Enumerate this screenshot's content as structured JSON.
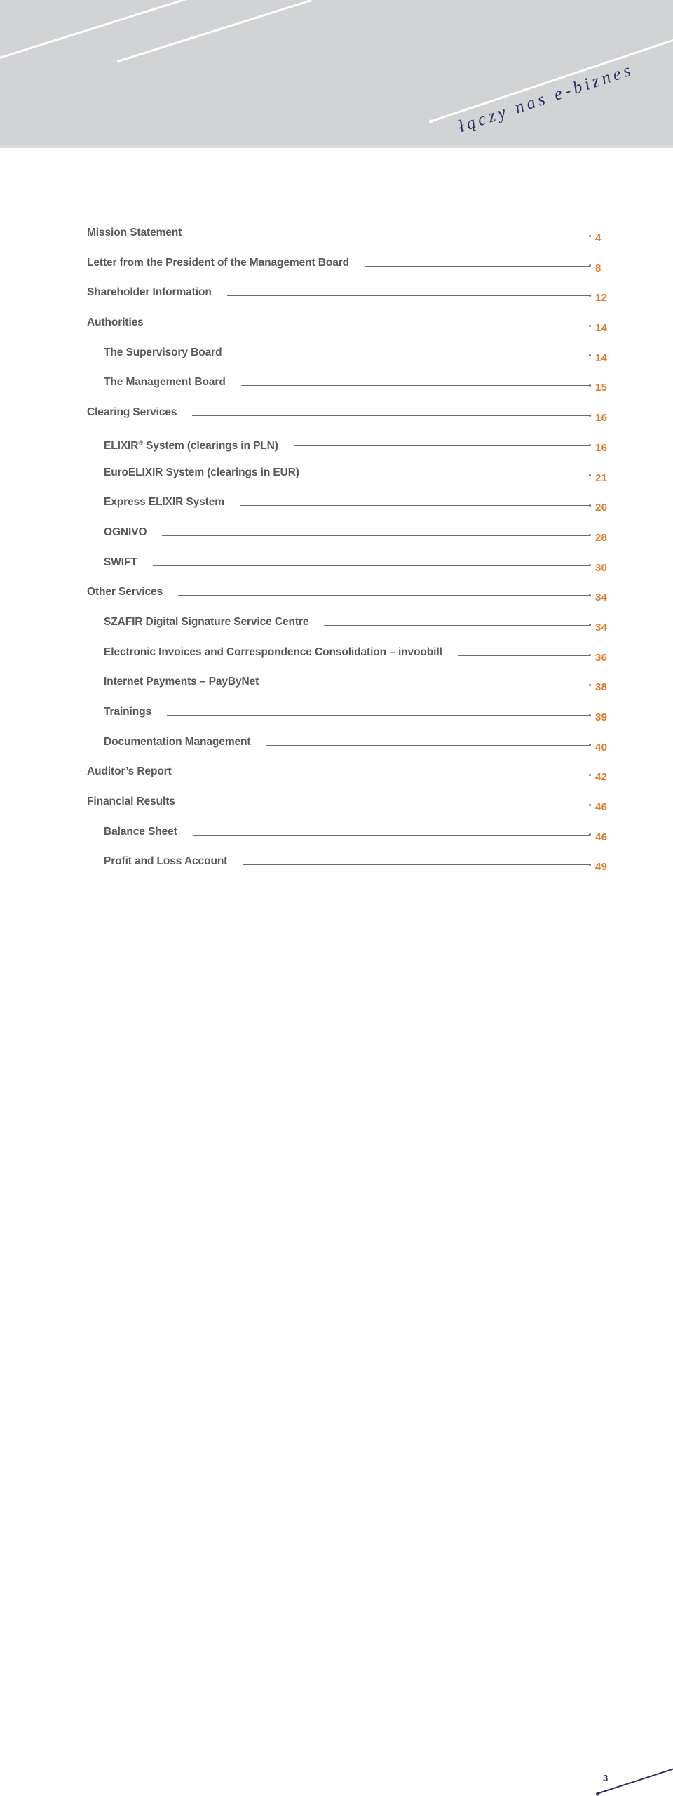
{
  "header": {
    "tagline": "łączy nas e-biznes",
    "band_color": "#d2d3d5",
    "tagline_color": "#2b3360"
  },
  "toc": {
    "label_color": "#58595b",
    "page_number_color": "#e07b2a",
    "leader_color": "#6d6e71",
    "entries": [
      {
        "label": "Mission Statement",
        "page": "4",
        "level": 0
      },
      {
        "label": "Letter from the President of the Management Board",
        "page": "8",
        "level": 0
      },
      {
        "label": "Shareholder Information",
        "page": "12",
        "level": 0
      },
      {
        "label": "Authorities",
        "page": "14",
        "level": 0
      },
      {
        "label": "The Supervisory Board",
        "page": "14",
        "level": 1
      },
      {
        "label": "The Management Board",
        "page": "15",
        "level": 1
      },
      {
        "label": "Clearing Services",
        "page": "16",
        "level": 0
      },
      {
        "label": "ELIXIR® System (clearings in PLN)",
        "page": "16",
        "level": 1,
        "registered": true,
        "pre": "ELIXIR",
        "post": " System (clearings in PLN)"
      },
      {
        "label": "EuroELIXIR System (clearings in EUR)",
        "page": "21",
        "level": 1
      },
      {
        "label": "Express ELIXIR System",
        "page": "26",
        "level": 1
      },
      {
        "label": "OGNIVO",
        "page": "28",
        "level": 1
      },
      {
        "label": "SWIFT",
        "page": "30",
        "level": 1
      },
      {
        "label": "Other Services",
        "page": "34",
        "level": 0
      },
      {
        "label": "SZAFIR Digital Signature Service Centre",
        "page": "34",
        "level": 1
      },
      {
        "label": "Electronic Invoices and Correspondence Consolidation – invoobill",
        "page": "36",
        "level": 1
      },
      {
        "label": "Internet Payments – PayByNet",
        "page": "38",
        "level": 1
      },
      {
        "label": "Trainings",
        "page": "39",
        "level": 1
      },
      {
        "label": "Documentation Management",
        "page": "40",
        "level": 1
      },
      {
        "label": "Auditor’s Report",
        "page": "42",
        "level": 0
      },
      {
        "label": "Financial Results",
        "page": "46",
        "level": 0
      },
      {
        "label": "Balance Sheet",
        "page": "46",
        "level": 1
      },
      {
        "label": "Profit and Loss Account",
        "page": "49",
        "level": 1
      }
    ]
  },
  "footer": {
    "folio": "3",
    "rule_color": "#2b3360"
  }
}
